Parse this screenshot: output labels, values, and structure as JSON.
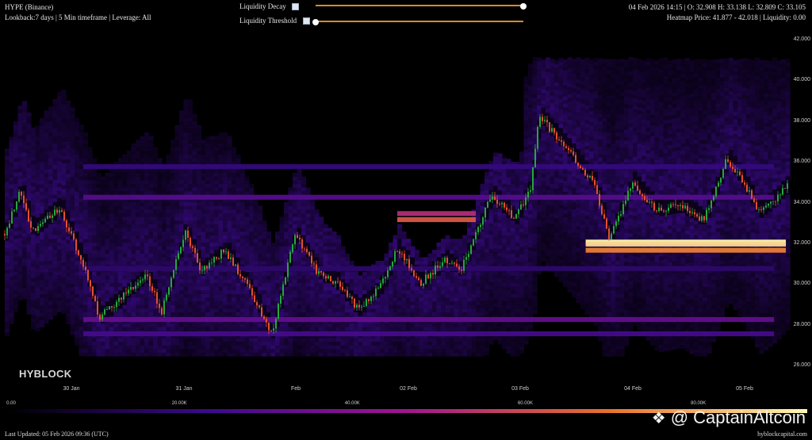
{
  "header": {
    "symbol": "HYPE (Binance)",
    "lookback": "Lookback:7 days | 5 Min timeframe | Leverage: All",
    "ohlc": "04 Feb 2026 14:15 | O: 32.908 H: 33.138 L: 32.809 C: 33.105",
    "heatmap_info": "Heatmap Price: 41.877 - 42.018 | Liquidity: 0.00"
  },
  "controls": {
    "decay_label": "Liquidity Decay",
    "threshold_label": "Liquidity Threshold",
    "decay_value": 1.0,
    "threshold_value": 0.0
  },
  "colors": {
    "background": "#000000",
    "slider": "#d98b2b",
    "up": "#26a641",
    "down": "#e2502f"
  },
  "footer": {
    "brand": "HYBLOCK",
    "updated": "Last Updated: 05 Feb 2026 09:36 (UTC)",
    "site": "hyblockcapital.com",
    "watermark": "@ CaptainAltcoin"
  },
  "chart_data": {
    "type": "heatmap",
    "title": "",
    "y_axis": {
      "ticks": [
        "26.000",
        "28.000",
        "30.000",
        "32.000",
        "34.000",
        "36.000",
        "38.000",
        "40.000",
        "42.000"
      ],
      "range": [
        25.5,
        42.5
      ]
    },
    "x_axis": {
      "ticks": [
        "30 Jan",
        "31 Jan",
        "Feb",
        "02 Feb",
        "03 Feb",
        "04 Feb",
        "05 Feb"
      ]
    },
    "legend": {
      "ticks": [
        "0.00",
        "20.00K",
        "40.00K",
        "60.00K",
        "80.00K"
      ],
      "colormap": [
        "#000000",
        "#3a0a8a",
        "#a0158f",
        "#e8702a",
        "#fff8b0"
      ]
    },
    "price_path": {
      "t": [
        0,
        0.02,
        0.035,
        0.07,
        0.1,
        0.12,
        0.15,
        0.18,
        0.2,
        0.23,
        0.25,
        0.28,
        0.31,
        0.33,
        0.34,
        0.37,
        0.4,
        0.42,
        0.45,
        0.48,
        0.5,
        0.53,
        0.56,
        0.58,
        0.6,
        0.62,
        0.65,
        0.67,
        0.68,
        0.72,
        0.75,
        0.77,
        0.8,
        0.83,
        0.86,
        0.89,
        0.92,
        0.94,
        0.96,
        0.98,
        1.0
      ],
      "price": [
        32.5,
        34.6,
        32.6,
        33.8,
        31.0,
        28.4,
        29.4,
        30.5,
        28.7,
        32.7,
        30.7,
        31.7,
        29.9,
        28.4,
        27.6,
        32.5,
        30.5,
        30.2,
        28.8,
        30.0,
        31.8,
        30.1,
        31.2,
        30.7,
        32.5,
        34.4,
        33.2,
        34.8,
        38.3,
        36.5,
        35.0,
        32.3,
        35.0,
        33.7,
        33.9,
        33.2,
        36.2,
        35.1,
        33.6,
        34.2,
        35.0
      ]
    },
    "liquidity_bands": [
      {
        "price": 32.1,
        "level": 80.0
      },
      {
        "price": 32.0,
        "level": 75.0
      },
      {
        "price": 31.7,
        "level": 62.0
      },
      {
        "price": 33.2,
        "level": 55.0
      },
      {
        "price": 33.5,
        "level": 45.0
      },
      {
        "price": 28.3,
        "level": 28.0
      },
      {
        "price": 34.3,
        "level": 25.0
      },
      {
        "price": 27.6,
        "level": 22.0
      },
      {
        "price": 35.8,
        "level": 18.0
      },
      {
        "price": 30.8,
        "level": 15.0
      }
    ]
  }
}
